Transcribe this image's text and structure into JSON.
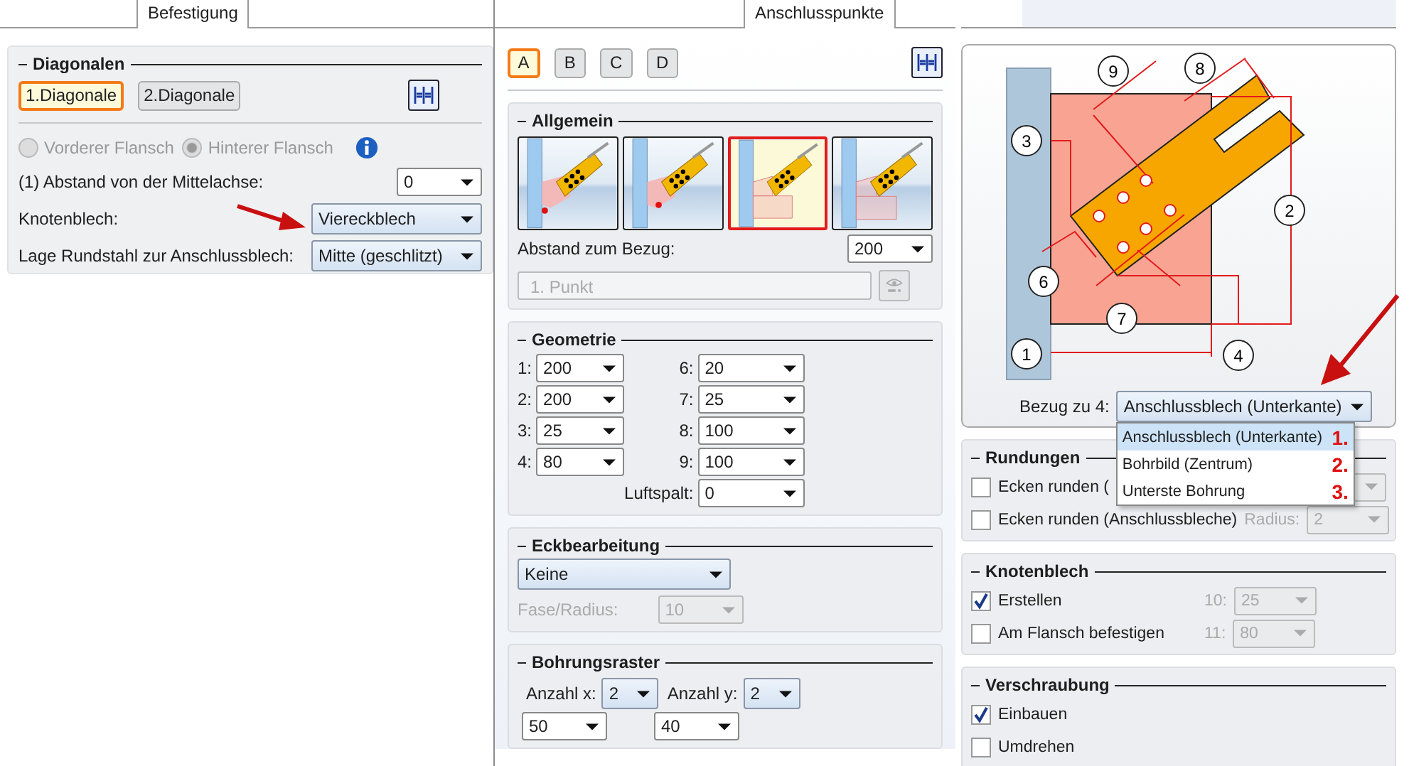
{
  "left": {
    "tab": {
      "label": "Befestigung",
      "selected": true
    },
    "diagonalen": {
      "title": "Diagonalen",
      "tabs": [
        {
          "label": "1.Diagonale",
          "selected": true
        },
        {
          "label": "2.Diagonale",
          "selected": false
        }
      ]
    },
    "radios": [
      {
        "label": "Vorderer Flansch",
        "selected": false,
        "disabled": true
      },
      {
        "label": "Hinterer Flansch",
        "selected": true,
        "disabled": true
      }
    ],
    "fields": [
      {
        "label": "(1) Abstand von der Mittelachse:",
        "value": "0",
        "kind": "edit"
      },
      {
        "label": "Knotenblech:",
        "value": "Viereckblech",
        "kind": "list"
      },
      {
        "label": "Lage Rundstahl zur Anschlussblech:",
        "value": "Mitte (geschlitzt)",
        "kind": "list"
      }
    ]
  },
  "middle": {
    "tab": {
      "label": "Anschlusspunkte",
      "selected": true
    },
    "points": [
      {
        "label": "A",
        "selected": true
      },
      {
        "label": "B",
        "selected": false
      },
      {
        "label": "C",
        "selected": false
      },
      {
        "label": "D",
        "selected": false
      }
    ],
    "allgemein": {
      "title": "Allgemein",
      "variants": [
        {
          "selected": false
        },
        {
          "selected": false
        },
        {
          "selected": true
        },
        {
          "selected": false
        }
      ],
      "distance": {
        "label": "Abstand zum Bezug:",
        "value": "200"
      },
      "point": {
        "value": "1. Punkt",
        "disabled": true
      }
    },
    "geometrie": {
      "title": "Geometrie",
      "left": [
        {
          "label": "1:",
          "value": "200"
        },
        {
          "label": "2:",
          "value": "200"
        },
        {
          "label": "3:",
          "value": "25"
        },
        {
          "label": "4:",
          "value": "80"
        }
      ],
      "right": [
        {
          "label": "6:",
          "value": "20"
        },
        {
          "label": "7:",
          "value": "25"
        },
        {
          "label": "8:",
          "value": "100"
        },
        {
          "label": "9:",
          "value": "100"
        }
      ],
      "gap": {
        "label": "Luftspalt:",
        "value": "0"
      }
    },
    "eckbearbeitung": {
      "title": "Eckbearbeitung",
      "mode": {
        "value": "Keine",
        "kind": "list"
      },
      "size": {
        "label": "Fase/Radius:",
        "value": "10",
        "disabled": true
      }
    },
    "bohrungsraster": {
      "title": "Bohrungsraster",
      "count_x": {
        "label": "Anzahl x:",
        "value": "2",
        "kind": "list"
      },
      "count_y": {
        "label": "Anzahl y:",
        "value": "2",
        "kind": "list"
      },
      "spacing_x": {
        "value": "50"
      },
      "spacing_y": {
        "value": "40"
      }
    }
  },
  "right": {
    "callouts": [
      "1",
      "2",
      "3",
      "4",
      "6",
      "7",
      "8",
      "9"
    ],
    "reference": {
      "label": "Bezug zu 4:",
      "value": "Anschlussblech (Unterkante)",
      "kind": "list",
      "expanded": true,
      "options": [
        {
          "label": "Anschlussblech (Unterkante)",
          "note": "1.",
          "selected": true
        },
        {
          "label": "Bohrbild (Zentrum)",
          "note": "2.",
          "selected": false
        },
        {
          "label": "Unterste Bohrung",
          "note": "3.",
          "selected": false
        }
      ]
    },
    "rundungen": {
      "title": "Rundungen",
      "rows": [
        {
          "label": "Ecken runden (",
          "checked": false,
          "field": {
            "disabled": true
          }
        },
        {
          "label": "Ecken runden (Anschlussbleche)",
          "checked": false,
          "field_label": "Radius:",
          "field": {
            "value": "2",
            "disabled": true
          }
        }
      ]
    },
    "knotenblech": {
      "title": "Knotenblech",
      "rows": [
        {
          "label": "Erstellen",
          "checked": true,
          "field_label": "10:",
          "field": {
            "value": "25",
            "disabled": true
          }
        },
        {
          "label": "Am Flansch befestigen",
          "checked": false,
          "field_label": "11:",
          "field": {
            "value": "80",
            "disabled": true
          }
        }
      ]
    },
    "verschraubung": {
      "title": "Verschraubung",
      "rows": [
        {
          "label": "Einbauen",
          "checked": true
        },
        {
          "label": "Umdrehen",
          "checked": false
        }
      ]
    }
  }
}
